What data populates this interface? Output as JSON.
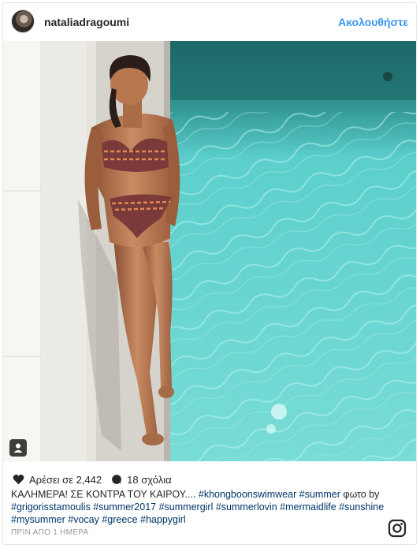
{
  "header": {
    "username": "nataliadragoumi",
    "follow_label": "Ακολουθήστε"
  },
  "actions": {
    "likes_label": "Αρέσει σε 2,442",
    "comments_label": "18 σχόλια"
  },
  "caption": {
    "segments": [
      {
        "text": "ΚΑΛΗΜΕΡΑ! ΣΕ ΚΟΝΤΡΑ ΤΟΥ ΚΑΙΡΟΥ.... ",
        "tag": false
      },
      {
        "text": "#khongboonswimwear",
        "tag": true
      },
      {
        "text": " ",
        "tag": false
      },
      {
        "text": "#summer",
        "tag": true
      },
      {
        "text": " φωτο by ",
        "tag": false
      },
      {
        "text": "#grigorisstamoulis",
        "tag": true
      },
      {
        "text": " ",
        "tag": false
      },
      {
        "text": "#summer2017",
        "tag": true
      },
      {
        "text": " ",
        "tag": false
      },
      {
        "text": "#summergirl",
        "tag": true
      },
      {
        "text": " ",
        "tag": false
      },
      {
        "text": "#summerlovin",
        "tag": true
      },
      {
        "text": " ",
        "tag": false
      },
      {
        "text": "#mermaidlife",
        "tag": true
      },
      {
        "text": " ",
        "tag": false
      },
      {
        "text": "#sunshine",
        "tag": true
      },
      {
        "text": " ",
        "tag": false
      },
      {
        "text": "#mysummer",
        "tag": true
      },
      {
        "text": " ",
        "tag": false
      },
      {
        "text": "#vocay",
        "tag": true
      },
      {
        "text": " ",
        "tag": false
      },
      {
        "text": "#greece",
        "tag": true
      },
      {
        "text": " ",
        "tag": false
      },
      {
        "text": "#happygirl",
        "tag": true
      }
    ]
  },
  "timestamp": "ΠΡΙΝ ΑΠΟ 1 ΗΜΕΡΑ",
  "icons": {
    "heart": "heart-icon",
    "comment": "comment-bubble-icon",
    "logo": "instagram-logo-icon",
    "badge": "user-tag-icon"
  },
  "colors": {
    "follow": "#3897f0",
    "hashtag": "#003569",
    "pool": "#5fc7c4",
    "timestamp": "#999999"
  }
}
